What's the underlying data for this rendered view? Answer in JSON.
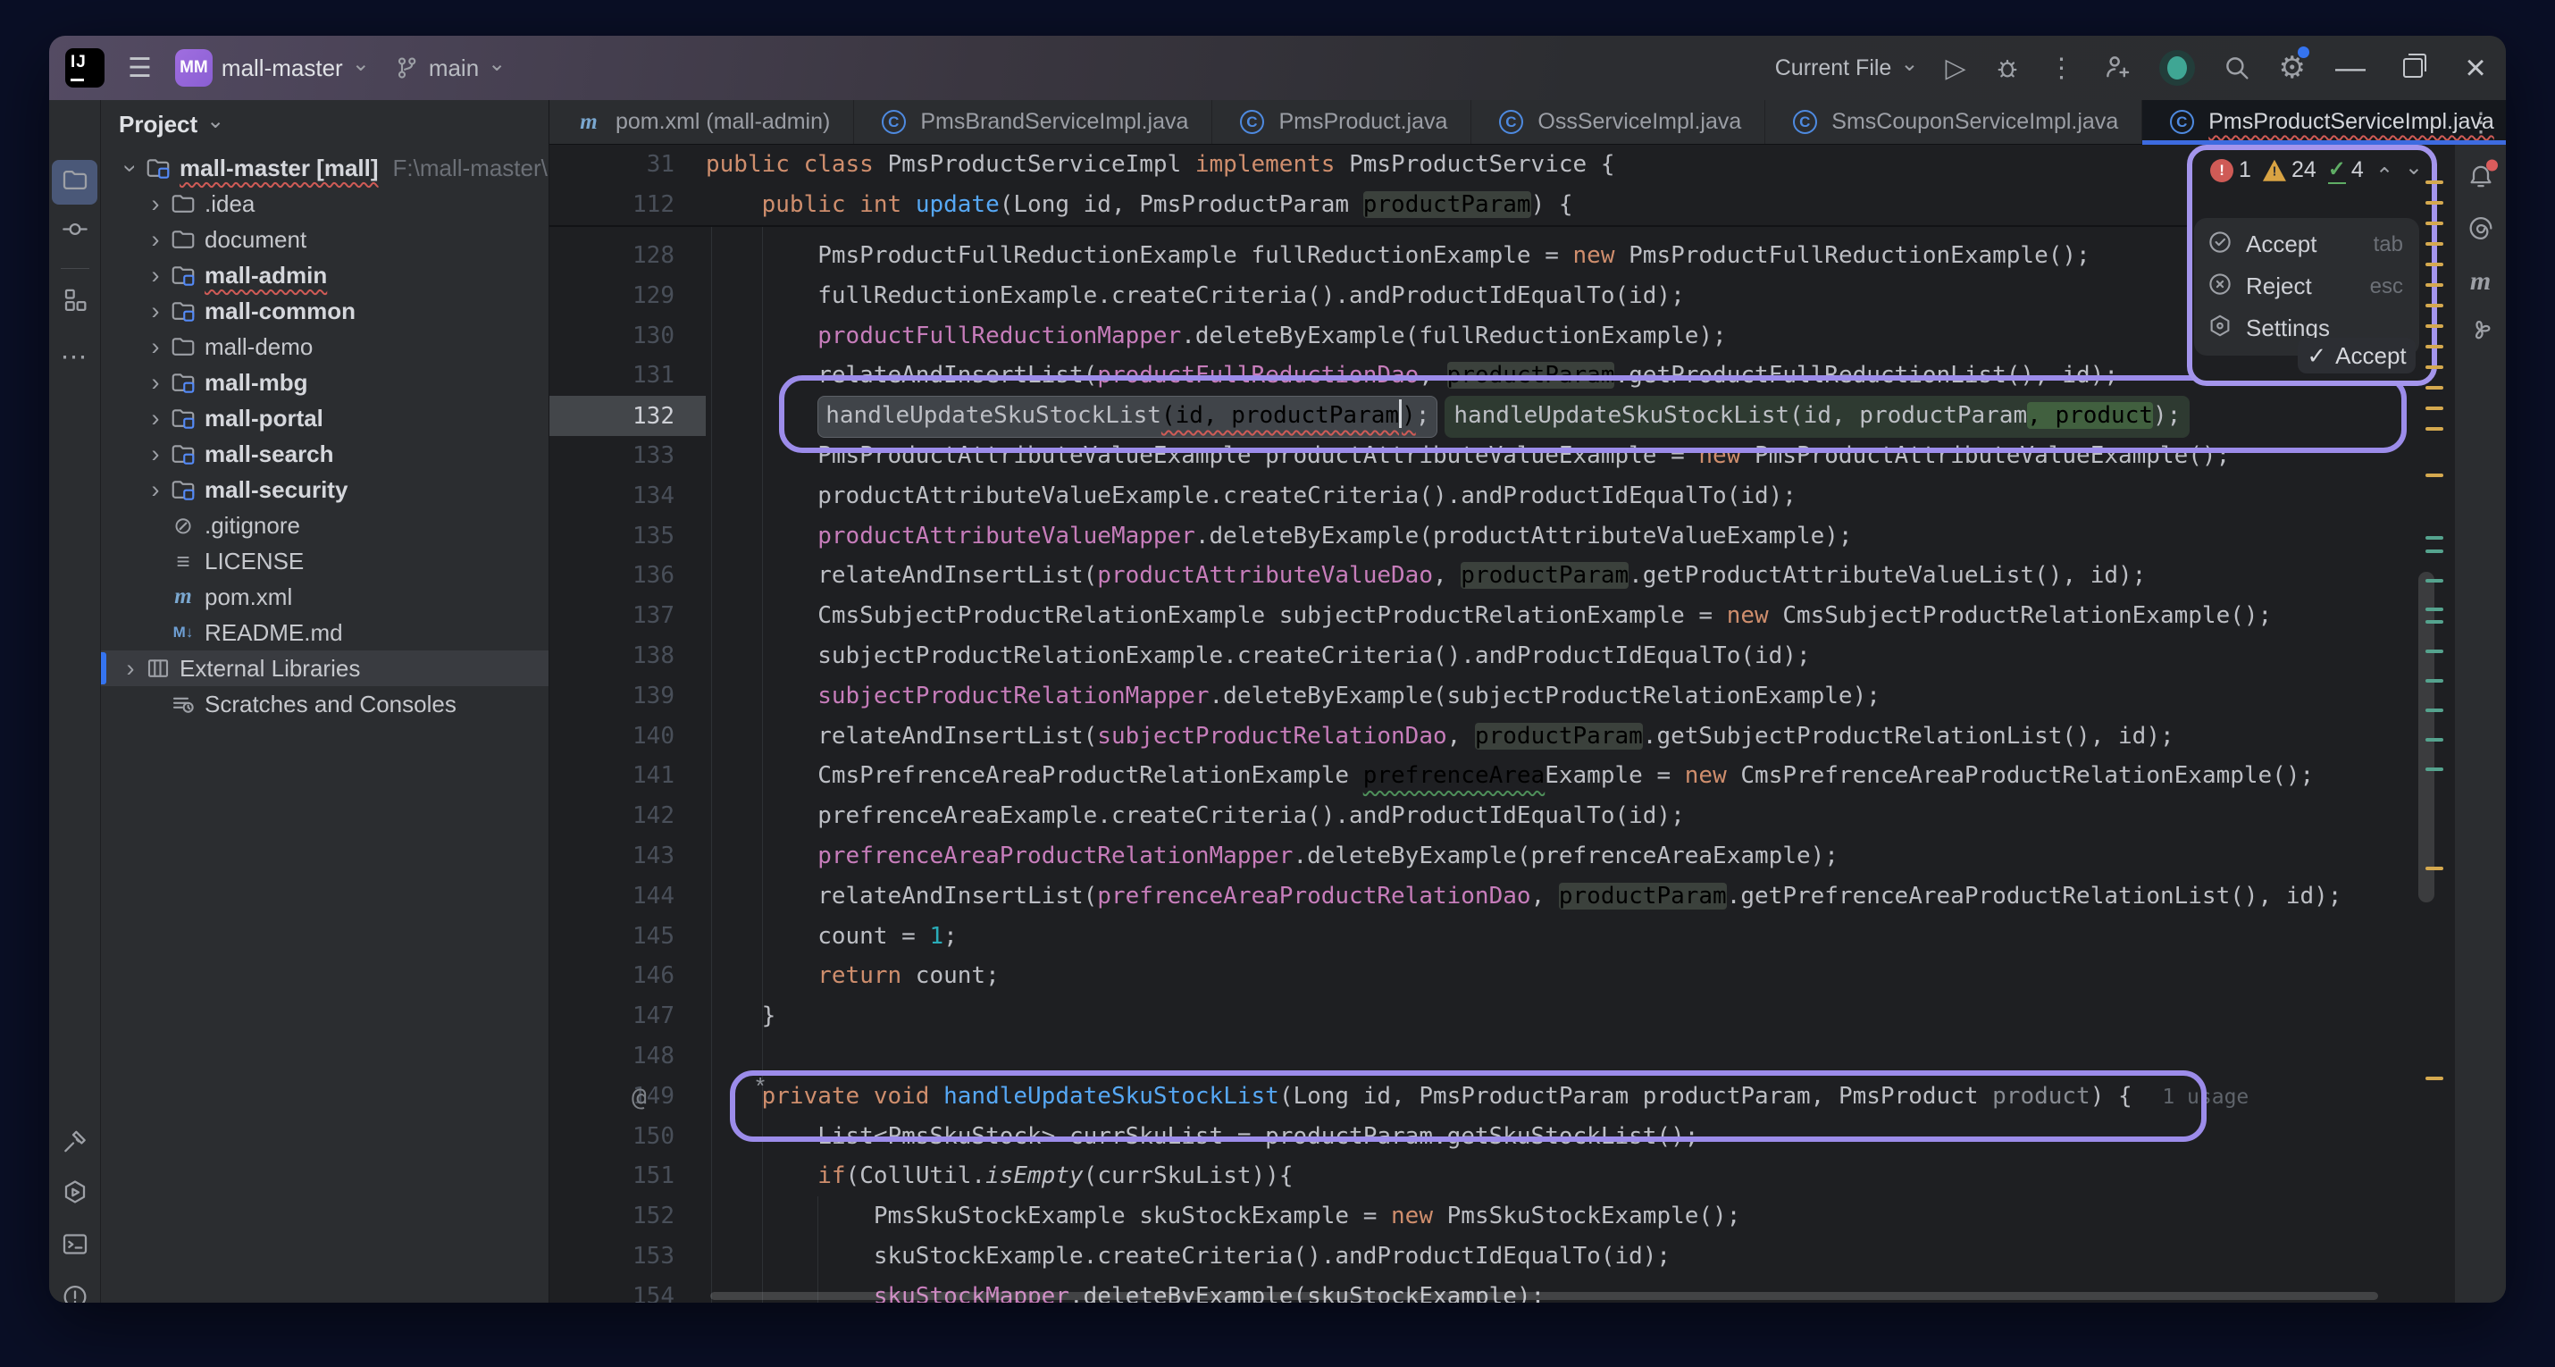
{
  "titlebar": {
    "logo": "IJ",
    "badge": "MM",
    "project": "mall-master",
    "branch": "main",
    "run_config": "Current File"
  },
  "window_controls": {
    "minimize": "—",
    "close": "×"
  },
  "glyphs": {
    "chevron_down": "⌄",
    "hamburger": "☰",
    "play": "▷",
    "kebab": "⋮",
    "tree_chevron": "›",
    "close_tab": "×",
    "check": "✓",
    "gear": "⚙",
    "at": "@",
    "sparkle": "*",
    "ignored": "⊘",
    "lines": "≡",
    "maven": "m",
    "markdown": "M↓"
  },
  "project_panel": {
    "header": "Project",
    "items": [
      {
        "label": "mall-master [mall]",
        "path": "F:\\mall-master\\mall-master",
        "icon": "module",
        "level": 0,
        "chevron": "expanded",
        "bold": true,
        "error": true
      },
      {
        "label": ".idea",
        "icon": "folder",
        "level": 1,
        "chevron": "collapsed"
      },
      {
        "label": "document",
        "icon": "folder",
        "level": 1,
        "chevron": "collapsed"
      },
      {
        "label": "mall-admin",
        "icon": "module",
        "level": 1,
        "chevron": "collapsed",
        "bold": true,
        "error": true
      },
      {
        "label": "mall-common",
        "icon": "module",
        "level": 1,
        "chevron": "collapsed",
        "bold": true
      },
      {
        "label": "mall-demo",
        "icon": "folder",
        "level": 1,
        "chevron": "collapsed"
      },
      {
        "label": "mall-mbg",
        "icon": "module",
        "level": 1,
        "chevron": "collapsed",
        "bold": true
      },
      {
        "label": "mall-portal",
        "icon": "module",
        "level": 1,
        "chevron": "collapsed",
        "bold": true
      },
      {
        "label": "mall-search",
        "icon": "module",
        "level": 1,
        "chevron": "collapsed",
        "bold": true
      },
      {
        "label": "mall-security",
        "icon": "module",
        "level": 1,
        "chevron": "collapsed",
        "bold": true
      },
      {
        "label": ".gitignore",
        "icon": "ignored",
        "level": 1
      },
      {
        "label": "LICENSE",
        "icon": "text",
        "level": 1
      },
      {
        "label": "pom.xml",
        "icon": "maven",
        "level": 1
      },
      {
        "label": "README.md",
        "icon": "markdown",
        "level": 1
      },
      {
        "label": "External Libraries",
        "icon": "library",
        "level": 0,
        "chevron": "collapsed",
        "selected": true
      },
      {
        "label": "Scratches and Consoles",
        "icon": "scratches",
        "level": 1
      }
    ]
  },
  "tabs": [
    {
      "label": "pom.xml (mall-admin)",
      "icon": "maven"
    },
    {
      "label": "PmsBrandServiceImpl.java",
      "icon": "class"
    },
    {
      "label": "PmsProduct.java",
      "icon": "class"
    },
    {
      "label": "OssServiceImpl.java",
      "icon": "class"
    },
    {
      "label": "SmsCouponServiceImpl.java",
      "icon": "class"
    },
    {
      "label": "PmsProductServiceImpl.java",
      "icon": "class",
      "active": true,
      "closable": true,
      "error": true
    }
  ],
  "editor": {
    "sticky_lines": [
      {
        "num": "31",
        "segs": [
          [
            "kw",
            "public class "
          ],
          [
            "t",
            "PmsProductServiceImpl "
          ],
          [
            "kw",
            "implements "
          ],
          [
            "t",
            "PmsProductService {"
          ]
        ]
      },
      {
        "num": "112",
        "segs": [
          [
            "t",
            "    "
          ],
          [
            "kw",
            "public int "
          ],
          [
            "decl",
            "update"
          ],
          [
            "t",
            "(Long id, PmsProductParam "
          ],
          [
            "hl",
            "productParam"
          ],
          [
            "t",
            ") {"
          ]
        ]
      }
    ],
    "lines": [
      {
        "num": "128",
        "segs": [
          [
            "t",
            "        PmsProductFullReductionExample fullReductionExample = "
          ],
          [
            "kw",
            "new"
          ],
          [
            "t",
            " PmsProductFullReductionExample();"
          ]
        ]
      },
      {
        "num": "129",
        "segs": [
          [
            "t",
            "        fullReductionExample.createCriteria().andProductIdEqualTo(id);"
          ]
        ]
      },
      {
        "num": "130",
        "segs": [
          [
            "t",
            "        "
          ],
          [
            "fld",
            "productFullReductionMapper"
          ],
          [
            "t",
            ".deleteByExample(fullReductionExample);"
          ]
        ]
      },
      {
        "num": "131",
        "segs": [
          [
            "t",
            "        relateAndInsertList("
          ],
          [
            "fld",
            "productFullReductionDao"
          ],
          [
            "t",
            ", "
          ],
          [
            "hl",
            "productParam"
          ],
          [
            "t",
            ".getProductFullReductionList(), id);"
          ]
        ]
      },
      {
        "num": "132",
        "current": true,
        "diff": {
          "indent": "        ",
          "old": [
            [
              "t",
              "handleUpdateSkuStockList"
            ],
            [
              "err",
              "(id, productParam"
            ],
            [
              "caret",
              ""
            ],
            [
              "err",
              ")"
            ],
            [
              "t",
              ";"
            ]
          ],
          "new": [
            [
              "t",
              "handleUpdateSkuStockList(id, productParam"
            ],
            [
              "add",
              ", product"
            ],
            [
              "t",
              ");"
            ]
          ]
        }
      },
      {
        "num": "133",
        "segs": [
          [
            "t",
            "        PmsProductAttributeValueExample productAttributeValueExample = "
          ],
          [
            "kw",
            "new"
          ],
          [
            "t",
            " PmsProductAttributeValueExample();"
          ]
        ]
      },
      {
        "num": "134",
        "segs": [
          [
            "t",
            "        productAttributeValueExample.createCriteria().andProductIdEqualTo(id);"
          ]
        ]
      },
      {
        "num": "135",
        "segs": [
          [
            "t",
            "        "
          ],
          [
            "fld",
            "productAttributeValueMapper"
          ],
          [
            "t",
            ".deleteByExample(productAttributeValueExample);"
          ]
        ]
      },
      {
        "num": "136",
        "segs": [
          [
            "t",
            "        relateAndInsertList("
          ],
          [
            "fld",
            "productAttributeValueDao"
          ],
          [
            "t",
            ", "
          ],
          [
            "hl",
            "productParam"
          ],
          [
            "t",
            ".getProductAttributeValueList(), id);"
          ]
        ]
      },
      {
        "num": "137",
        "segs": [
          [
            "t",
            "        CmsSubjectProductRelationExample subjectProductRelationExample = "
          ],
          [
            "kw",
            "new"
          ],
          [
            "t",
            " CmsSubjectProductRelationExample();"
          ]
        ]
      },
      {
        "num": "138",
        "segs": [
          [
            "t",
            "        subjectProductRelationExample.createCriteria().andProductIdEqualTo(id);"
          ]
        ]
      },
      {
        "num": "139",
        "segs": [
          [
            "t",
            "        "
          ],
          [
            "fld",
            "subjectProductRelationMapper"
          ],
          [
            "t",
            ".deleteByExample(subjectProductRelationExample);"
          ]
        ]
      },
      {
        "num": "140",
        "segs": [
          [
            "t",
            "        relateAndInsertList("
          ],
          [
            "fld",
            "subjectProductRelationDao"
          ],
          [
            "t",
            ", "
          ],
          [
            "hl",
            "productParam"
          ],
          [
            "t",
            ".getSubjectProductRelationList(), id);"
          ]
        ]
      },
      {
        "num": "141",
        "segs": [
          [
            "t",
            "        CmsPrefrenceAreaProductRelationExample "
          ],
          [
            "typo",
            "prefrenceArea"
          ],
          [
            "t",
            "Example = "
          ],
          [
            "kw",
            "new"
          ],
          [
            "t",
            " CmsPrefrenceAreaProductRelationExample();"
          ]
        ]
      },
      {
        "num": "142",
        "segs": [
          [
            "t",
            "        prefrenceAreaExample.createCriteria().andProductIdEqualTo(id);"
          ]
        ]
      },
      {
        "num": "143",
        "segs": [
          [
            "t",
            "        "
          ],
          [
            "fld",
            "prefrenceAreaProductRelationMapper"
          ],
          [
            "t",
            ".deleteByExample(prefrenceAreaExample);"
          ]
        ]
      },
      {
        "num": "144",
        "segs": [
          [
            "t",
            "        relateAndInsertList("
          ],
          [
            "fld",
            "prefrenceAreaProductRelationDao"
          ],
          [
            "t",
            ", "
          ],
          [
            "hl",
            "productParam"
          ],
          [
            "t",
            ".getPrefrenceAreaProductRelationList(), id);"
          ]
        ]
      },
      {
        "num": "145",
        "segs": [
          [
            "t",
            "        count = "
          ],
          [
            "num",
            "1"
          ],
          [
            "t",
            ";"
          ]
        ]
      },
      {
        "num": "146",
        "segs": [
          [
            "t",
            "        "
          ],
          [
            "kw",
            "return"
          ],
          [
            "t",
            " count;"
          ]
        ]
      },
      {
        "num": "147",
        "segs": [
          [
            "t",
            "    }"
          ]
        ]
      },
      {
        "num": "148",
        "segs": []
      },
      {
        "num": "149",
        "gutter_icon": "@",
        "segs": [
          [
            "t",
            "    "
          ],
          [
            "kw",
            "private void "
          ],
          [
            "decl",
            "handleUpdateSkuStockList"
          ],
          [
            "t",
            "(Long id, PmsProductParam productParam, PmsProduct "
          ],
          [
            "gray",
            "product"
          ],
          [
            "t",
            ") { "
          ],
          [
            "hint",
            "1 usage"
          ]
        ]
      },
      {
        "num": "150",
        "segs": [
          [
            "t",
            "        List<PmsSkuStock> currSkuList = productParam.getSkuStockList();"
          ]
        ]
      },
      {
        "num": "151",
        "segs": [
          [
            "t",
            "        "
          ],
          [
            "kw",
            "if"
          ],
          [
            "t",
            "(CollUtil."
          ],
          [
            "it",
            "isEmpty"
          ],
          [
            "t",
            "(currSkuList)){"
          ]
        ]
      },
      {
        "num": "152",
        "segs": [
          [
            "t",
            "            PmsSkuStockExample skuStockExample = "
          ],
          [
            "kw",
            "new"
          ],
          [
            "t",
            " PmsSkuStockExample();"
          ]
        ]
      },
      {
        "num": "153",
        "segs": [
          [
            "t",
            "            skuStockExample.createCriteria().andProductIdEqualTo(id);"
          ]
        ]
      },
      {
        "num": "154",
        "segs": [
          [
            "t",
            "            "
          ],
          [
            "fld",
            "skuStockMapper"
          ],
          [
            "t",
            ".deleteByExample(skuStockExample);"
          ]
        ]
      }
    ]
  },
  "suggestion_popup": {
    "errors": "1",
    "warnings": "24",
    "weak_warnings": "4",
    "menu": [
      {
        "label": "Accept",
        "shortcut": "tab",
        "icon": "check-circle"
      },
      {
        "label": "Reject",
        "shortcut": "esc",
        "icon": "x-circle"
      },
      {
        "label": "Settings",
        "shortcut": "",
        "icon": "settings-hex"
      }
    ],
    "accept_button": "Accept"
  },
  "colors": {
    "accent_purple": "#9c8cea",
    "tab_underline": "#3d6be0",
    "stripe_yellow": "#d5a94f",
    "stripe_teal": "#55a38e",
    "selection_blue": "#3574f0"
  }
}
